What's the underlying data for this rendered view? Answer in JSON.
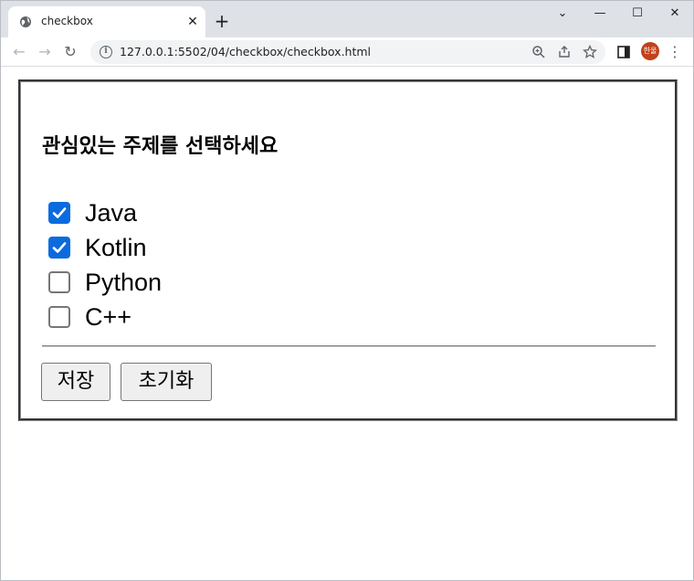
{
  "browser": {
    "tab_title": "checkbox",
    "tab_close": "✕",
    "new_tab": "+",
    "url": "127.0.0.1:5502/04/checkbox/checkbox.html",
    "profile_initials": "한울",
    "window_controls": {
      "chevron": "⌄",
      "minimize": "—",
      "maximize": "☐",
      "close": "✕"
    },
    "nav": {
      "back": "←",
      "forward": "→",
      "reload": "↻"
    },
    "menu": "⋮"
  },
  "form": {
    "heading": "관심있는 주제를 선택하세요",
    "options": [
      {
        "label": "Java",
        "checked": true
      },
      {
        "label": "Kotlin",
        "checked": true
      },
      {
        "label": "Python",
        "checked": false
      },
      {
        "label": "C++",
        "checked": false
      }
    ],
    "save_label": "저장",
    "reset_label": "초기화"
  },
  "colors": {
    "checkbox_checked": "#0b6bde",
    "tabstrip_bg": "#dee1e6",
    "profile_bg": "#c0421b"
  }
}
